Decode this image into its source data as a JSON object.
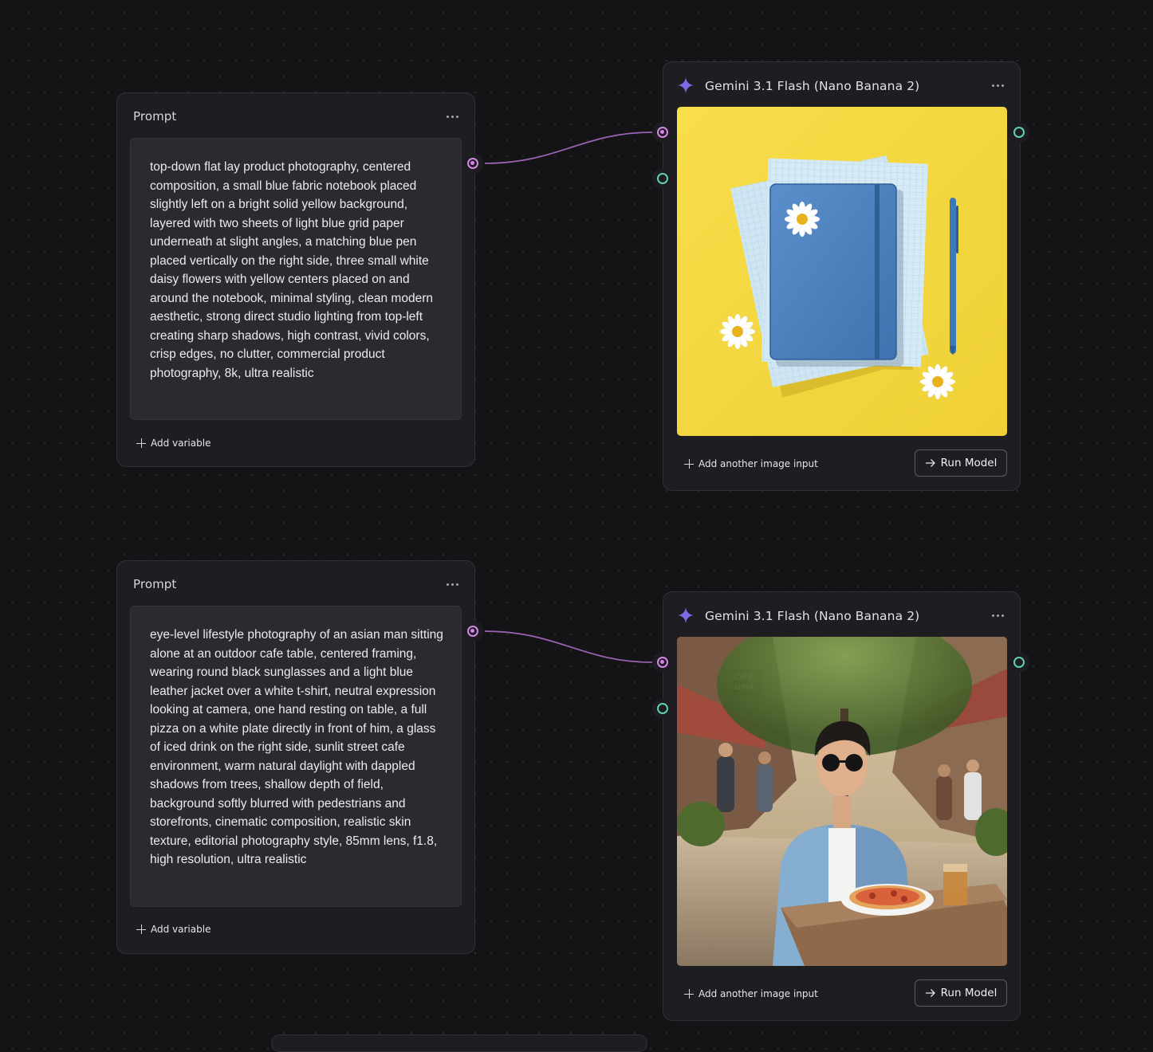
{
  "colors": {
    "canvas_bg": "#141417",
    "node_bg": "#1e1e22",
    "text_port": "#d487e6",
    "image_port": "#5fd0b4",
    "edge": "#9b63b5",
    "sparkle": "#7d6ae8"
  },
  "nodes": [
    {
      "prompt": {
        "title": "Prompt",
        "text": "top-down flat lay product photography, centered composition, a small blue fabric notebook placed slightly left on a bright solid yellow background, layered with two sheets of light blue grid paper underneath at slight angles, a matching blue pen placed vertically on the right side, three small white daisy flowers with yellow centers placed on and around the notebook, minimal styling, clean modern aesthetic, strong direct studio lighting from top-left creating sharp shadows, high contrast, vivid colors, crisp edges, no clutter, commercial product photography, 8k, ultra realistic",
        "add_variable_label": "Add variable",
        "menu_icon": "more-horizontal-icon"
      },
      "model": {
        "icon": "sparkle-icon",
        "title": "Gemini 3.1 Flash (Nano Banana 2)",
        "image_subject": "blue notebook with daisies and pen on yellow background",
        "add_image_label": "Add another image input",
        "run_label": "Run Model",
        "run_icon": "arrow-right-icon",
        "menu_icon": "more-horizontal-icon"
      }
    },
    {
      "prompt": {
        "title": "Prompt",
        "text": "eye-level lifestyle photography of an asian man sitting alone at an outdoor cafe table, centered framing, wearing round black sunglasses and a light blue leather jacket over a white t-shirt, neutral expression looking at camera, one hand resting on table, a full pizza on a white plate directly in front of him, a glass of iced drink on the right side, sunlit street cafe environment, warm natural daylight with dappled shadows from trees, shallow depth of field, background softly blurred with pedestrians and storefronts, cinematic composition, realistic skin texture, editorial photography style, 85mm lens, f1.8, high resolution, ultra realistic",
        "add_variable_label": "Add variable",
        "menu_icon": "more-horizontal-icon"
      },
      "model": {
        "icon": "sparkle-icon",
        "title": "Gemini 3.1 Flash (Nano Banana 2)",
        "image_subject": "man in sunglasses and blue jacket at outdoor cafe table with pizza",
        "add_image_label": "Add another image input",
        "run_label": "Run Model",
        "run_icon": "arrow-right-icon",
        "menu_icon": "more-horizontal-icon",
        "image_sign_text": "CAFÉ LUNA"
      }
    }
  ]
}
